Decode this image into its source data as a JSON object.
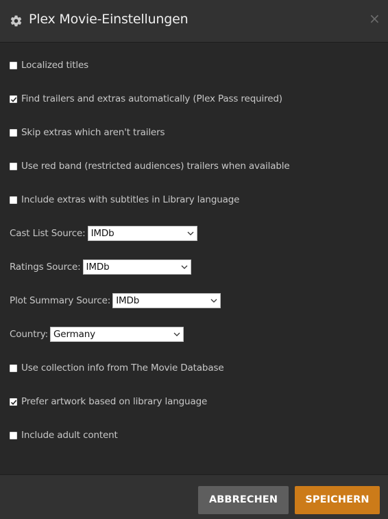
{
  "header": {
    "title": "Plex Movie-Einstellungen",
    "icon": "gear-icon",
    "close_icon": "close-icon"
  },
  "settings": {
    "localized_titles": {
      "label": "Localized titles",
      "checked": false
    },
    "find_trailers": {
      "label": "Find trailers and extras automatically (Plex Pass required)",
      "checked": true
    },
    "skip_extras": {
      "label": "Skip extras which aren't trailers",
      "checked": false
    },
    "red_band": {
      "label": "Use red band (restricted audiences) trailers when available",
      "checked": false
    },
    "extras_subtitles": {
      "label": "Include extras with subtitles in Library language",
      "checked": false
    },
    "cast_list_source": {
      "label": "Cast List Source:",
      "value": "IMDb"
    },
    "ratings_source": {
      "label": "Ratings Source:",
      "value": "IMDb"
    },
    "plot_summary_source": {
      "label": "Plot Summary Source:",
      "value": "IMDb"
    },
    "country": {
      "label": "Country:",
      "value": "Germany"
    },
    "collection_info": {
      "label": "Use collection info from The Movie Database",
      "checked": false
    },
    "prefer_artwork": {
      "label": "Prefer artwork based on library language",
      "checked": true
    },
    "adult_content": {
      "label": "Include adult content",
      "checked": false
    }
  },
  "footer": {
    "cancel_label": "ABBRECHEN",
    "save_label": "SPEICHERN"
  },
  "colors": {
    "background": "#282828",
    "header": "#323232",
    "accent": "#cc7b19",
    "cancel_button": "#5e5e5e"
  }
}
